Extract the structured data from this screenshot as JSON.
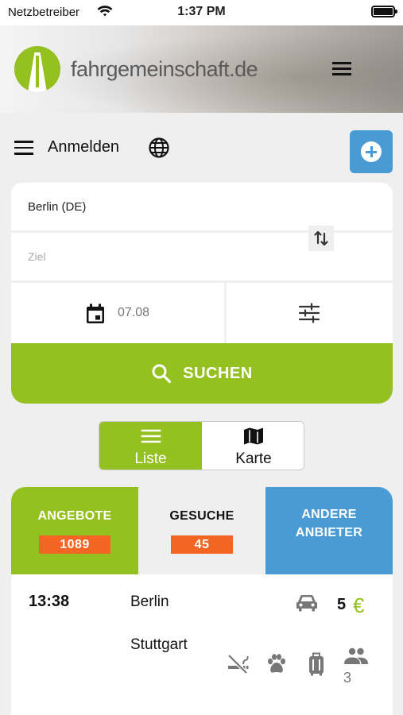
{
  "status_bar": {
    "carrier": "Netzbetreiber",
    "time": "1:37 PM"
  },
  "header": {
    "brand": "fahrgemeinschaft.de",
    "logo_icon": "road-logo-icon",
    "menu_icon": "hamburger-menu-icon"
  },
  "toolbar": {
    "login_label": "Anmelden",
    "menu_icon": "hamburger-menu-icon",
    "language_icon": "globe-icon",
    "add_icon": "plus-circle-icon"
  },
  "search": {
    "from_value": "Berlin (DE)",
    "to_placeholder": "Ziel",
    "date_value": "07.08",
    "button_label": "SUCHEN",
    "swap_icon": "swap-vertical-icon",
    "calendar_icon": "calendar-icon",
    "filter_icon": "sliders-icon",
    "search_icon": "search-icon"
  },
  "view_toggle": {
    "list_label": "Liste",
    "map_label": "Karte",
    "selected": "Liste"
  },
  "tabs": {
    "offers": {
      "title": "ANGEBOTE",
      "count": "1089"
    },
    "requests": {
      "title": "GESUCHE",
      "count": "45"
    },
    "others": {
      "title_line1": "ANDERE",
      "title_line2": "ANBIETER"
    }
  },
  "ride": {
    "time": "13:38",
    "from": "Berlin",
    "to": "Stuttgart",
    "price": "5",
    "currency": "€",
    "seats": "3",
    "icons": [
      "car-icon",
      "no-smoking-icon",
      "paw-icon",
      "luggage-icon",
      "people-icon"
    ]
  },
  "colors": {
    "accent_green": "#94c11f",
    "accent_blue": "#4a9bd4",
    "badge_orange": "#f26522"
  }
}
